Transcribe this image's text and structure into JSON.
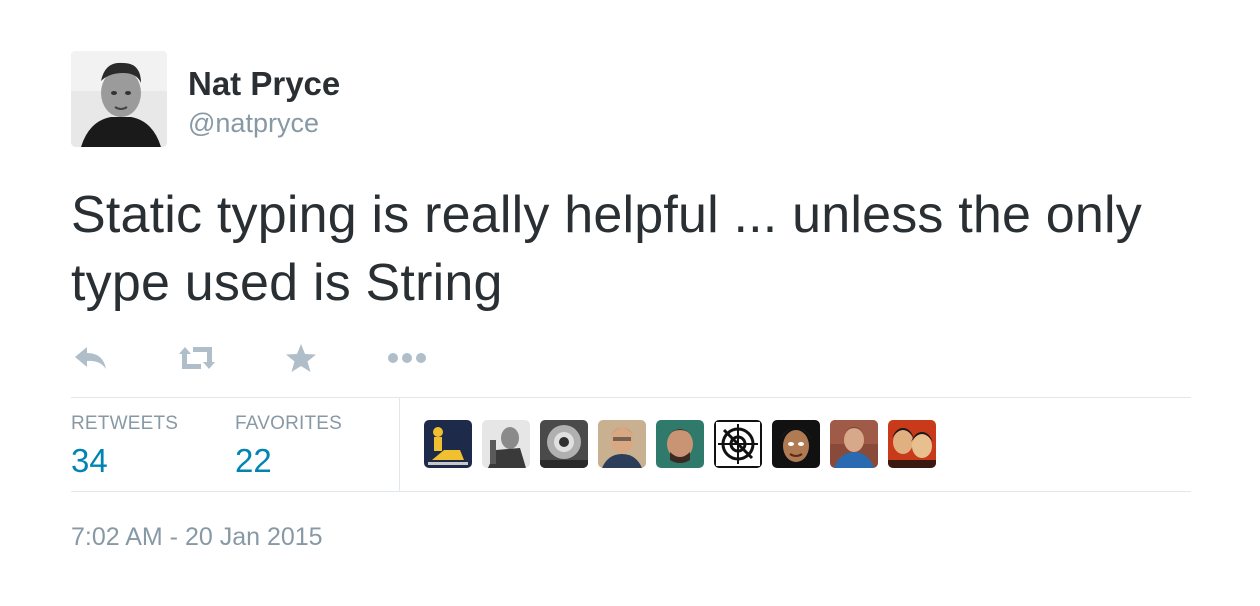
{
  "author": {
    "name": "Nat Pryce",
    "handle": "@natpryce"
  },
  "tweet": {
    "text": "Static typing is really helpful ... unless the only type used is String",
    "timestamp": "7:02 AM - 20 Jan 2015"
  },
  "actions": {
    "reply_icon": "reply-icon",
    "retweet_icon": "retweet-icon",
    "favorite_icon": "star-icon",
    "more_icon": "more-dots-icon",
    "icon_color": "#afbec9"
  },
  "stats": {
    "retweets_label": "RETWEETS",
    "retweets_count": "34",
    "favorites_label": "FAVORITES",
    "favorites_count": "22"
  },
  "favoriters_count_shown": 9,
  "colors": {
    "text": "#292f33",
    "muted": "#8899a6",
    "link": "#0084b4",
    "border": "#e1e8ed"
  }
}
